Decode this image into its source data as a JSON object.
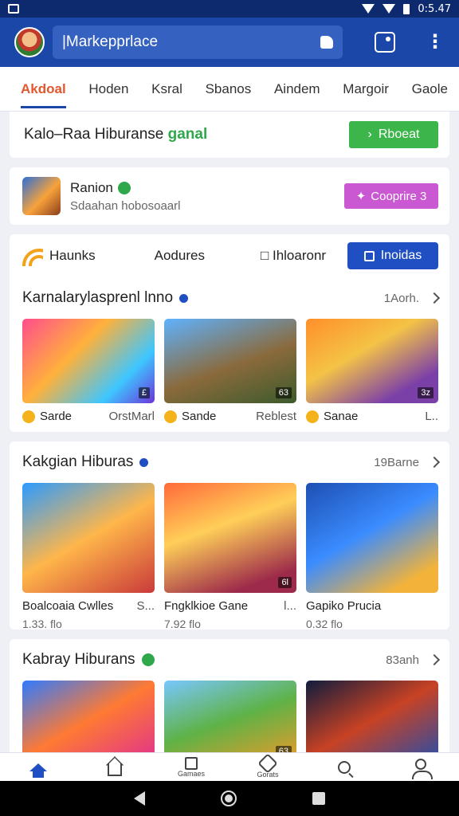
{
  "status": {
    "time": "0:5.47"
  },
  "appbar": {
    "search_text": "|Markepprlace"
  },
  "tabs": [
    "Akdoal",
    "Hoden",
    "Ksral",
    "Sbanos",
    "Aindem",
    "Margoir",
    "Gaole"
  ],
  "banner": {
    "text_main": "Kalo–Raa Hiburanse ",
    "text_accent": "ganal",
    "button": "Rboeat"
  },
  "profile": {
    "name": "Ranion",
    "subtitle": "Sdaahan hobosoaarl",
    "button": "Cooprire 3"
  },
  "filters": {
    "a": "Haunks",
    "b": "Aodures",
    "c": "Ihloaronr",
    "button": "Inoidas"
  },
  "sections": [
    {
      "title": "Karnalarylasprenl lnno",
      "meta": "1Aorh.",
      "tiles": [
        {
          "badge": "£",
          "left": "Sarde",
          "right": "OrstMarl"
        },
        {
          "badge": "63",
          "left": "Sande",
          "right": "Reblest"
        },
        {
          "badge": "3z",
          "left": "Sanae",
          "right": "L.."
        }
      ]
    },
    {
      "title": "Kakgian Hiburas",
      "meta": "19Barne",
      "tiles": [
        {
          "badge": "",
          "left": "Boalcoaia Cwlles",
          "right": "S...",
          "line2": "1.33. flo"
        },
        {
          "badge": "6l",
          "left": "Fngklkioe Gane",
          "right": "l...",
          "line2": "7.92 flo"
        },
        {
          "badge": "",
          "left": "Gapiko Prucia",
          "right": "",
          "line2": "0.32 flo"
        }
      ]
    },
    {
      "title": "Kabray Hiburans",
      "meta": "83anh",
      "tiles": [
        {
          "badge": ""
        },
        {
          "badge": "63"
        },
        {
          "badge": ""
        }
      ]
    }
  ],
  "bottomnav": {
    "item3": "Gamaes",
    "item4": "Gorats"
  }
}
